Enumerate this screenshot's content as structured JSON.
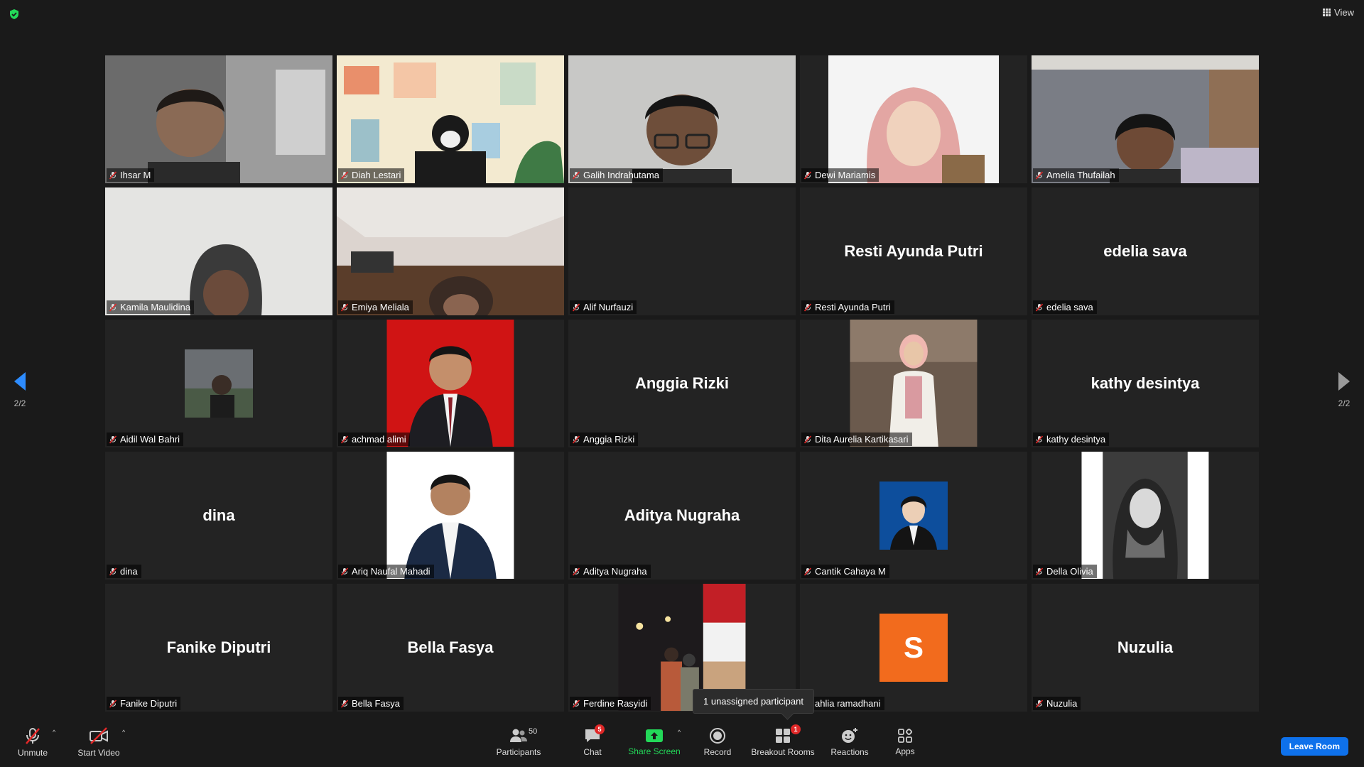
{
  "header": {
    "view_label": "View"
  },
  "participants": [
    {
      "name": "Ihsar M",
      "video": "person-room"
    },
    {
      "name": "Diah Lestari",
      "video": "illustrated-room"
    },
    {
      "name": "Galih Indrahutama",
      "video": "person-glasses"
    },
    {
      "name": "Dewi Mariamis",
      "video": "person-hijab"
    },
    {
      "name": "Amelia Thufailah",
      "video": "person-bedroom"
    },
    {
      "name": "Kamila Maulidina",
      "video": "person-hood"
    },
    {
      "name": "Emiya Meliala",
      "video": "person-ceiling"
    },
    {
      "name": "Alif Nurfauzi",
      "display_name": ""
    },
    {
      "name": "Resti Ayunda Putri",
      "display_name": "Resti Ayunda Putri"
    },
    {
      "name": "edelia sava",
      "display_name": "edelia sava"
    },
    {
      "name": "Aidil Wal Bahri",
      "video": "small-photo"
    },
    {
      "name": "achmad alimi",
      "video": "portrait-red"
    },
    {
      "name": "Anggia Rizki",
      "display_name": "Anggia Rizki"
    },
    {
      "name": "Dita Aurelia Kartikasari",
      "video": "portrait-standing"
    },
    {
      "name": "kathy desintya",
      "display_name": "kathy desintya"
    },
    {
      "name": "dina",
      "display_name": "dina"
    },
    {
      "name": "Ariq Naufal Mahadi",
      "video": "portrait-white"
    },
    {
      "name": "Aditya Nugraha",
      "display_name": "Aditya Nugraha"
    },
    {
      "name": "Cantik Cahaya M",
      "video": "small-portrait-blue"
    },
    {
      "name": "Della Olivia",
      "video": "portrait-bw"
    },
    {
      "name": "Fanike Diputri",
      "display_name": "Fanike Diputri"
    },
    {
      "name": "Bella Fasya",
      "display_name": "Bella Fasya"
    },
    {
      "name": "Ferdine Rasyidi",
      "video": "night-photo"
    },
    {
      "name": "ahlia ramadhani",
      "avatar_letter": "S"
    },
    {
      "name": "Nuzulia",
      "display_name": "Nuzulia"
    }
  ],
  "pagination": {
    "left_page": "2/2",
    "right_page": "2/2"
  },
  "tooltip": {
    "text": "1 unassigned participant"
  },
  "toolbar": {
    "unmute": "Unmute",
    "start_video": "Start Video",
    "participants": "Participants",
    "participants_count": "50",
    "chat": "Chat",
    "chat_badge": "5",
    "share_screen": "Share Screen",
    "record": "Record",
    "breakout_rooms": "Breakout Rooms",
    "breakout_badge": "1",
    "reactions": "Reactions",
    "apps": "Apps",
    "leave_room": "Leave Room"
  },
  "colors": {
    "background": "#1a1a1a",
    "tile": "#232323",
    "accent_blue": "#0e71eb",
    "share_green": "#23d959",
    "mute_red": "#e02828",
    "avatar_orange": "#f26b1d"
  }
}
